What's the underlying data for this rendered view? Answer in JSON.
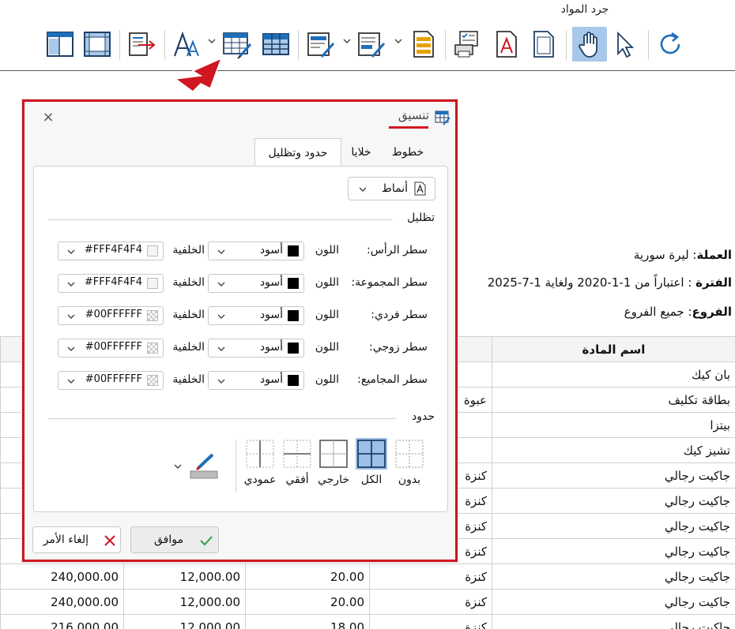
{
  "toolbar": {
    "title": "جرد المواد",
    "icons": [
      "layout-icon",
      "grid-frame-icon",
      "export-icon",
      "font-icon",
      "table-format-icon",
      "table-grid-icon",
      "edit-doc-icon",
      "edit-doc-2-icon",
      "document-icon",
      "print-preview-icon",
      "pdf-icon",
      "page-icon",
      "hand-tool-icon",
      "pointer-icon",
      "refresh-icon"
    ]
  },
  "report": {
    "currency_label": "العملة",
    "currency_value": "ليرة سورية",
    "period_label": "الفترة",
    "period_value": "اعتباراً من 1-1-2020 ولغاية 1-7-2025",
    "branches_label": "الفروع",
    "branches_value": "جميع الفروع",
    "column_header": "اسم المادة",
    "rows": [
      {
        "name": "بان كيك",
        "unit": "",
        "c3": "",
        "c4": "",
        "c5": ""
      },
      {
        "name": "بطاقة تكليف",
        "unit": "عبوة",
        "c3": "",
        "c4": "",
        "c5": ""
      },
      {
        "name": "بيتزا",
        "unit": "",
        "c3": "",
        "c4": "",
        "c5": ""
      },
      {
        "name": "تشيز كيك",
        "unit": "",
        "c3": "",
        "c4": "",
        "c5": ""
      },
      {
        "name": "جاكيت رجالي",
        "unit": "كنزة",
        "c3": "",
        "c4": "",
        "c5": ""
      },
      {
        "name": "جاكيت رجالي",
        "unit": "كنزة",
        "c3": "",
        "c4": "",
        "c5": ""
      },
      {
        "name": "جاكيت رجالي",
        "unit": "كنزة",
        "c3": "",
        "c4": "",
        "c5": ""
      },
      {
        "name": "جاكيت رجالي",
        "unit": "كنزة",
        "c3": "",
        "c4": "",
        "c5": ""
      },
      {
        "name": "جاكيت رجالي",
        "unit": "كنزة",
        "c3": "20.00",
        "c4": "12,000.00",
        "c5": "240,000.00"
      },
      {
        "name": "جاكيت رجالي",
        "unit": "كنزة",
        "c3": "20.00",
        "c4": "12,000.00",
        "c5": "240,000.00"
      },
      {
        "name": "جاكيت رجالي",
        "unit": "كنزة",
        "c3": "18.00",
        "c4": "12,000.00",
        "c5": "216,000.00"
      }
    ]
  },
  "dialog": {
    "title": "تنسيق",
    "close_label": "×",
    "tabs": [
      "خطوط",
      "خلايا",
      "حدود وتظليل"
    ],
    "styles_label": "أنماط",
    "shading_title": "تظليل",
    "color_label": "اللون",
    "background_label": "الخلفية",
    "shading_rows": [
      {
        "label": "سطر الرأس:",
        "color": "أسود",
        "background": "#FFF4F4F4",
        "swatch": "light"
      },
      {
        "label": "سطر المجموعة:",
        "color": "أسود",
        "background": "#FFF4F4F4",
        "swatch": "light"
      },
      {
        "label": "سطر فردي:",
        "color": "أسود",
        "background": "#00FFFFFF",
        "swatch": "checker"
      },
      {
        "label": "سطر زوجي:",
        "color": "أسود",
        "background": "#00FFFFFF",
        "swatch": "checker"
      },
      {
        "label": "سطر المجاميع:",
        "color": "أسود",
        "background": "#00FFFFFF",
        "swatch": "checker"
      }
    ],
    "borders_title": "حدود",
    "border_options": [
      "بدون",
      "الكل",
      "خارجي",
      "أفقي",
      "عمودي"
    ],
    "ok_label": "موافق",
    "cancel_label": "إلغاء الأمر"
  },
  "colors": {
    "accent_red": "#d0161f",
    "selection_blue": "#9cc0e8",
    "icon_blue": "#1f6fb8"
  }
}
